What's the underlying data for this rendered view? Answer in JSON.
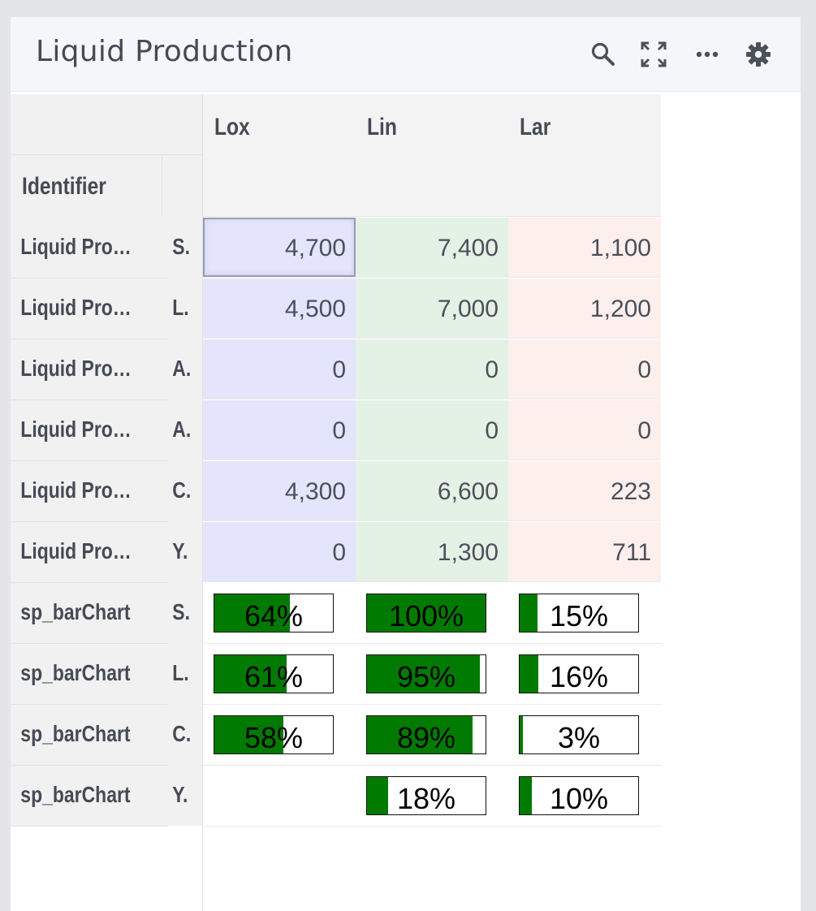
{
  "header": {
    "title": "Liquid Production",
    "icons": [
      "search-icon",
      "expand-icon",
      "more-icon",
      "settings-icon"
    ]
  },
  "table": {
    "corner_label": "Identifier",
    "columns": [
      "Lox",
      "Lin",
      "Lar"
    ],
    "rows": [
      {
        "name": "Liquid Pro…",
        "code": "S.",
        "values": [
          "4,700",
          "7,400",
          "1,100"
        ]
      },
      {
        "name": "Liquid Pro…",
        "code": "L.",
        "values": [
          "4,500",
          "7,000",
          "1,200"
        ]
      },
      {
        "name": "Liquid Pro…",
        "code": "A.",
        "values": [
          "0",
          "0",
          "0"
        ]
      },
      {
        "name": "Liquid Pro…",
        "code": "A.",
        "values": [
          "0",
          "0",
          "0"
        ]
      },
      {
        "name": "Liquid Pro…",
        "code": "C.",
        "values": [
          "4,300",
          "6,600",
          "223"
        ]
      },
      {
        "name": "Liquid Pro…",
        "code": "Y.",
        "values": [
          "0",
          "1,300",
          "711"
        ]
      }
    ],
    "bar_rows": [
      {
        "name": "sp_barChart",
        "code": "S.",
        "bars": [
          {
            "label": "64%",
            "fraction": 0.64
          },
          {
            "label": "100%",
            "fraction": 1.0
          },
          {
            "label": "15%",
            "fraction": 0.15
          }
        ]
      },
      {
        "name": "sp_barChart",
        "code": "L.",
        "bars": [
          {
            "label": "61%",
            "fraction": 0.61
          },
          {
            "label": "95%",
            "fraction": 0.95
          },
          {
            "label": "16%",
            "fraction": 0.16
          }
        ]
      },
      {
        "name": "sp_barChart",
        "code": "C.",
        "bars": [
          {
            "label": "58%",
            "fraction": 0.58
          },
          {
            "label": "89%",
            "fraction": 0.89
          },
          {
            "label": "3%",
            "fraction": 0.03
          }
        ]
      },
      {
        "name": "sp_barChart",
        "code": "Y.",
        "bars": [
          null,
          {
            "label": "18%",
            "fraction": 0.18
          },
          {
            "label": "10%",
            "fraction": 0.1
          }
        ]
      }
    ]
  },
  "colors": {
    "lox": "#e4e5fc",
    "lin": "#e4f1e5",
    "lar": "#fdf0ec",
    "bar_fill": "#007a00"
  }
}
